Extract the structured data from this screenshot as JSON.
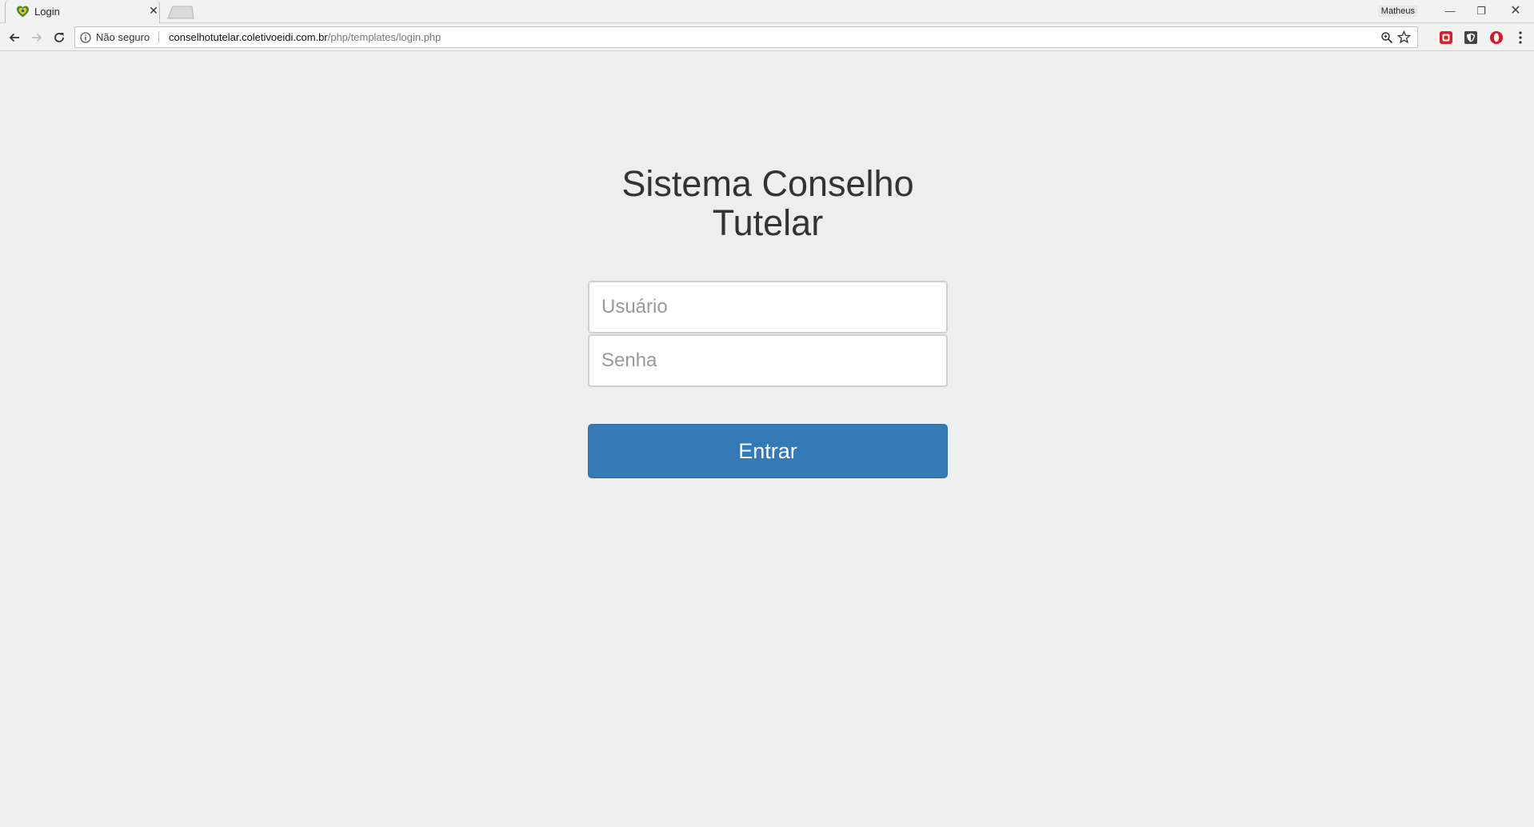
{
  "browser": {
    "tab": {
      "title": "Login",
      "favicon": "heart-shield-favicon"
    },
    "profile_name": "Matheus",
    "window_controls": {
      "minimize": "—",
      "maximize": "❐",
      "close": "✕"
    },
    "address_bar": {
      "security_label": "Não seguro",
      "url_host": "conselhotutelar.coletivoeidi.com.br",
      "url_path": "/php/templates/login.php"
    },
    "extensions": [
      "red-shield-extension-icon",
      "dark-shield-extension-icon",
      "opera-red-extension-icon"
    ],
    "colors": {
      "chrome_bg": "#f2f2f2",
      "page_bg": "#eeeeee"
    }
  },
  "page": {
    "title": "Sistema Conselho Tutelar",
    "form": {
      "username_placeholder": "Usuário",
      "username_value": "",
      "password_placeholder": "Senha",
      "password_value": "",
      "submit_label": "Entrar"
    },
    "colors": {
      "button_bg": "#337ab7",
      "button_text": "#ffffff",
      "title_text": "#333333"
    }
  }
}
